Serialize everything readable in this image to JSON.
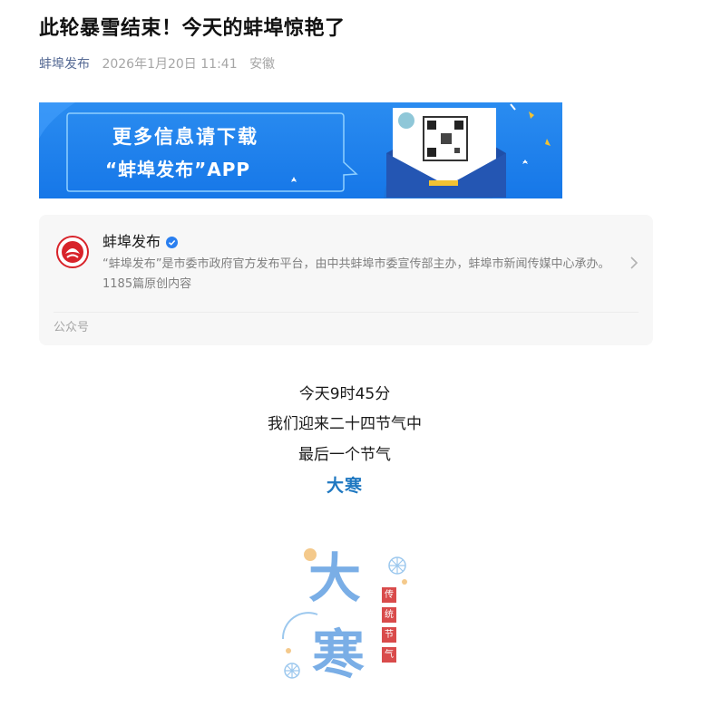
{
  "article": {
    "title": "此轮暴雪结束！今天的蚌埠惊艳了",
    "author": "蚌埠发布",
    "date": "2026年1月20日 11:41",
    "location": "安徽"
  },
  "banner": {
    "line1": "更多信息请下载",
    "line2": "“蚌埠发布”APP",
    "colors": {
      "background": "#1677e8",
      "accent": "#ffffff"
    }
  },
  "account_card": {
    "name": "蚌埠发布",
    "verified_icon": "verified-badge-icon",
    "description": "“蚌埠发布”是市委市政府官方发布平台，由中共蚌埠市委宣传部主办，蚌埠市新闻传媒中心承办。",
    "original_count": "1185篇原创内容",
    "type_label": "公众号"
  },
  "content": {
    "line1": "今天9时45分",
    "line2": "我们迎来二十四节气中",
    "line3": "最后一个节气",
    "highlight": "大寒",
    "highlight_color": "#1f78c1"
  },
  "poster": {
    "big_chars": [
      "大",
      "寒"
    ],
    "side_tags": [
      "传",
      "统",
      "节",
      "气"
    ]
  }
}
